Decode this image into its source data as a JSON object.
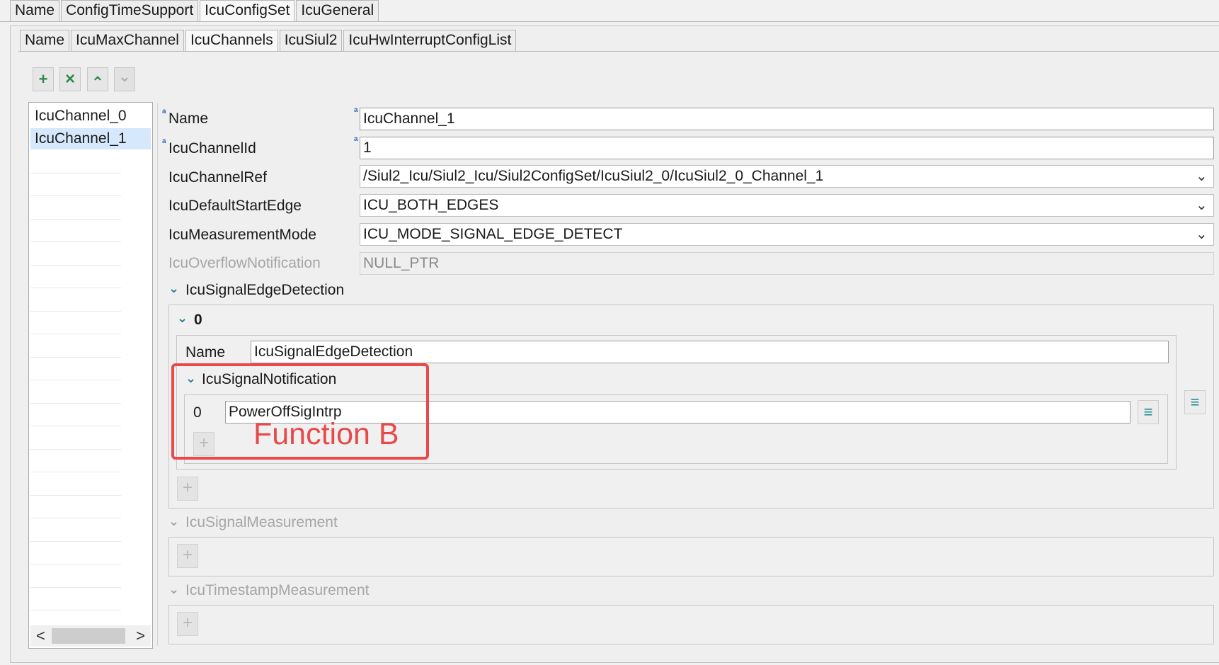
{
  "top_tabs": [
    "Name",
    "ConfigTimeSupport",
    "IcuConfigSet",
    "IcuGeneral"
  ],
  "sub_tabs": [
    "Name",
    "IcuMaxChannel",
    "IcuChannels",
    "IcuSiul2",
    "IcuHwInterruptConfigList"
  ],
  "toolbar": {
    "add": "+",
    "remove": "×",
    "up": "⌃",
    "down": "⌄"
  },
  "channels": [
    "IcuChannel_0",
    "IcuChannel_1"
  ],
  "scroll": {
    "left": "<",
    "right": ">"
  },
  "form": {
    "name_label": "Name",
    "name_value": "IcuChannel_1",
    "id_label": "IcuChannelId",
    "id_value": "1",
    "ref_label": "IcuChannelRef",
    "ref_value": "/Siul2_Icu/Siul2_Icu/Siul2ConfigSet/IcuSiul2_0/IcuSiul2_0_Channel_1",
    "edge_label": "IcuDefaultStartEdge",
    "edge_value": "ICU_BOTH_EDGES",
    "mode_label": "IcuMeasurementMode",
    "mode_value": "ICU_MODE_SIGNAL_EDGE_DETECT",
    "overflow_label": "IcuOverflowNotification",
    "overflow_value": "NULL_PTR",
    "required_marker": "a",
    "chevron": "⌄"
  },
  "edge_detection": {
    "title": "IcuSignalEdgeDetection",
    "index": "0",
    "name_label": "Name",
    "name_value": "IcuSignalEdgeDetection",
    "notification_title": "IcuSignalNotification",
    "notif_index": "0",
    "notif_value": "PowerOffSigIntrp",
    "menu_glyph": "≡"
  },
  "signal_measurement": {
    "title": "IcuSignalMeasurement"
  },
  "timestamp_measurement": {
    "title": "IcuTimestampMeasurement"
  },
  "annotation": {
    "text": "Function B",
    "color": "#e84a4a"
  },
  "colors": {
    "selection": "#d6e8fb",
    "accent_green": "#2d8a4a",
    "accent_teal": "#1e8a8f"
  }
}
